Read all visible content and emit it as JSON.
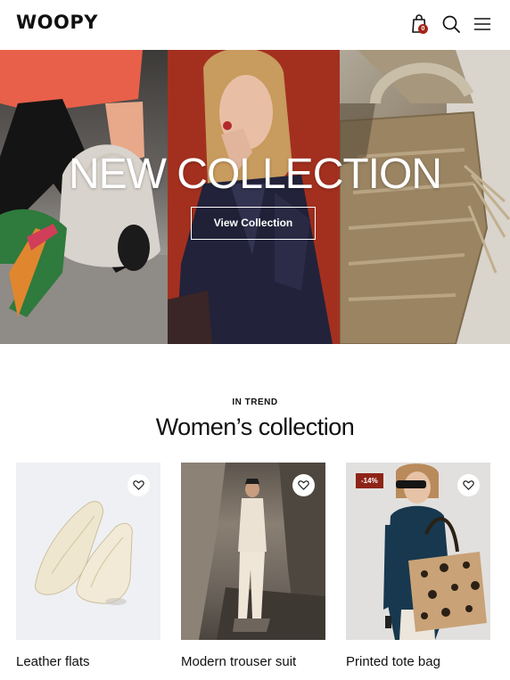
{
  "header": {
    "logo": "WOOPY",
    "cart_count": "0",
    "icons": [
      "shopping-bag-icon",
      "search-icon",
      "menu-icon"
    ]
  },
  "hero": {
    "title": "NEW COLLECTION",
    "button_label": "View Collection"
  },
  "section": {
    "eyebrow": "IN TREND",
    "title": "Women’s collection"
  },
  "products": [
    {
      "name": "Leather flats",
      "price": "",
      "badge": ""
    },
    {
      "name": "Modern trouser suit",
      "price": "",
      "badge": ""
    },
    {
      "name": "Printed tote bag",
      "price": "",
      "badge": "-14%"
    }
  ],
  "colors": {
    "brand_accent": "#a3271a",
    "sale_badge": "#8e2418",
    "text": "#111111"
  }
}
